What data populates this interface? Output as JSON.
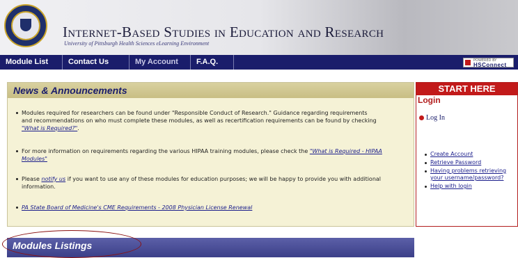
{
  "header": {
    "title": "Internet-Based Studies in Education and Research",
    "subtitle": "University of Pittsburgh Health Sciences eLearning Environment",
    "seal_text": "UNIVERSITY OF PITTSBURGH"
  },
  "nav": {
    "items": [
      {
        "label": "Module List"
      },
      {
        "label": "Contact Us"
      },
      {
        "label": "My Account"
      },
      {
        "label": "F.A.Q."
      }
    ],
    "badge_powered": "POWERED BY",
    "badge_brand": "HSConnect"
  },
  "news": {
    "title": "News & Announcements",
    "items": [
      {
        "text": "Modules required for researchers can be found under \"Responsible Conduct of Research.\" Guidance regarding requirements and recommendations on who must complete these modules, as well as recertification requirements can be found by checking ",
        "link": "\"What is Required?\"",
        "after": "."
      },
      {
        "text": "For more information on requirements regarding the various HIPAA training modules, please check the ",
        "link": "\"What is Required - HIPAA Modules\"",
        "after": ""
      },
      {
        "text": "Please ",
        "link": "notify us",
        "after": " if you want to use any of these modules for education purposes; we will be happy to provide you with additional information."
      },
      {
        "text": "",
        "link": "PA State Board of Medicine's CME Requirements - 2008 Physician License Renewal",
        "after": ""
      }
    ]
  },
  "modules": {
    "title": "Modules Listings"
  },
  "start": {
    "title": "START HERE",
    "login_label": "Login",
    "login_button": "Log In",
    "links": [
      "Create Account",
      "Retrieve Password",
      "Having problems retrieving your username/password?",
      "Help with login"
    ]
  },
  "colors": {
    "nav_bg": "#1a1d6b",
    "news_bg": "#f5f2d6",
    "start_accent": "#c21a1a",
    "modules_bg": "#4a4e98"
  }
}
